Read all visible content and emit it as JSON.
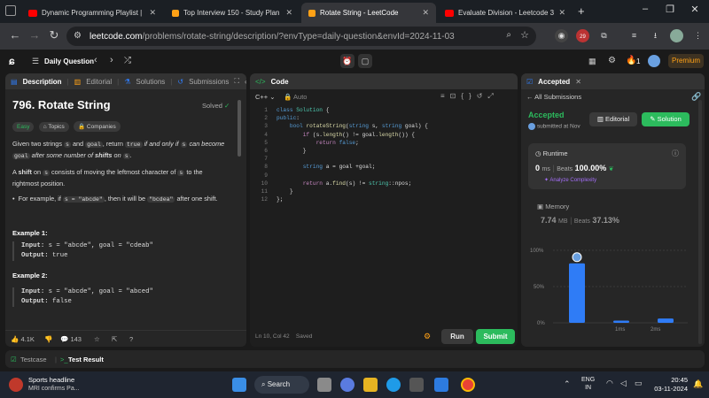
{
  "browser": {
    "tabs": [
      {
        "title": "Dynamic Programming Playlist | In",
        "favicon_color": "#ff0000"
      },
      {
        "title": "Top Interview 150 - Study Plan - Le",
        "favicon_color": "#ffa116"
      },
      {
        "title": "Rotate String - LeetCode",
        "favicon_color": "#ffa116",
        "active": true
      },
      {
        "title": "Evaluate Division - Leetcode 399",
        "favicon_color": "#ff0000"
      }
    ],
    "url_host": "leetcode.com",
    "url_path": "/problems/rotate-string/description/?envType=daily-question&envId=2024-11-03",
    "ext_badge": "29"
  },
  "lc_header": {
    "daily_label": "Daily Question",
    "streak": "1",
    "premium_label": "Premium"
  },
  "left_panel": {
    "tabs": [
      "Description",
      "Editorial",
      "Solutions",
      "Submissions"
    ],
    "title": "796. Rotate String",
    "solved": "Solved",
    "difficulty": "Easy",
    "topics": "Topics",
    "companies": "Companies",
    "p1": {
      "a": "Given two strings",
      "s": "s",
      "and": "and",
      "goal": "goal",
      "b": ", return",
      "true": "true",
      "c": "if and only if",
      "d": "can become",
      "e": "after some number of",
      "shifts": "shifts",
      "on": "on",
      "end": "."
    },
    "p2": {
      "a": "A",
      "shift": "shift",
      "b": "on",
      "s": "s",
      "c": "consists of moving the leftmost character of",
      "d": "to the rightmost position."
    },
    "bullet": {
      "a": "For example, if",
      "code1": "s = \"abcde\"",
      "b": ", then it will be",
      "code2": "\"bcdea\"",
      "c": "after one shift."
    },
    "ex1": {
      "title": "Example 1:",
      "input_label": "Input:",
      "input": "s = \"abcde\", goal = \"cdeab\"",
      "output_label": "Output:",
      "output": "true"
    },
    "ex2": {
      "title": "Example 2:",
      "input_label": "Input:",
      "input": "s = \"abcde\", goal = \"abced\"",
      "output_label": "Output:",
      "output": "false"
    },
    "likes": "4.1K",
    "comments": "143"
  },
  "code_panel": {
    "title": "Code",
    "language": "C++",
    "mode": "Auto",
    "lines": [
      "class Solution {",
      "public:",
      "    bool rotateString(string s, string goal) {",
      "        if (s.length() != goal.length()) {",
      "            return false;",
      "        }",
      "",
      "        string a = goal +goal;",
      "",
      "        return a.find(s) != string::npos;",
      "    }",
      "};"
    ],
    "status": "Ln 10, Col 42",
    "saved": "Saved",
    "run": "Run",
    "submit": "Submit"
  },
  "right_panel": {
    "tab": "Accepted",
    "back": "All Submissions",
    "status": "Accepted",
    "submitted": "submitted at Nov",
    "editorial_btn": "Editorial",
    "solution_btn": "Solution",
    "runtime_label": "Runtime",
    "runtime_value": "0",
    "runtime_unit": "ms",
    "beats_label": "Beats",
    "runtime_beats": "100.00%",
    "analyze": "Analyze Complexity",
    "memory_label": "Memory",
    "memory_value": "7.74",
    "memory_unit": "MB",
    "memory_beats": "37.13%",
    "y_ticks": [
      "100%",
      "50%",
      "0%"
    ],
    "x_ticks": [
      "1ms",
      "2ms"
    ]
  },
  "chart_data": {
    "type": "bar",
    "categories": [
      "0ms",
      "1ms",
      "2ms"
    ],
    "values": [
      82,
      3,
      6
    ],
    "ylim": [
      0,
      100
    ],
    "highlight_index": 0,
    "color": "#2f7cf6"
  },
  "bottom_bar": {
    "testcase": "Testcase",
    "test_result": "Test Result"
  },
  "taskbar": {
    "news_title": "Sports headline",
    "news_sub": "MRI confirms Pa...",
    "search": "Search",
    "lang1": "ENG",
    "lang2": "IN",
    "time": "20:45",
    "date": "03-11-2024"
  }
}
